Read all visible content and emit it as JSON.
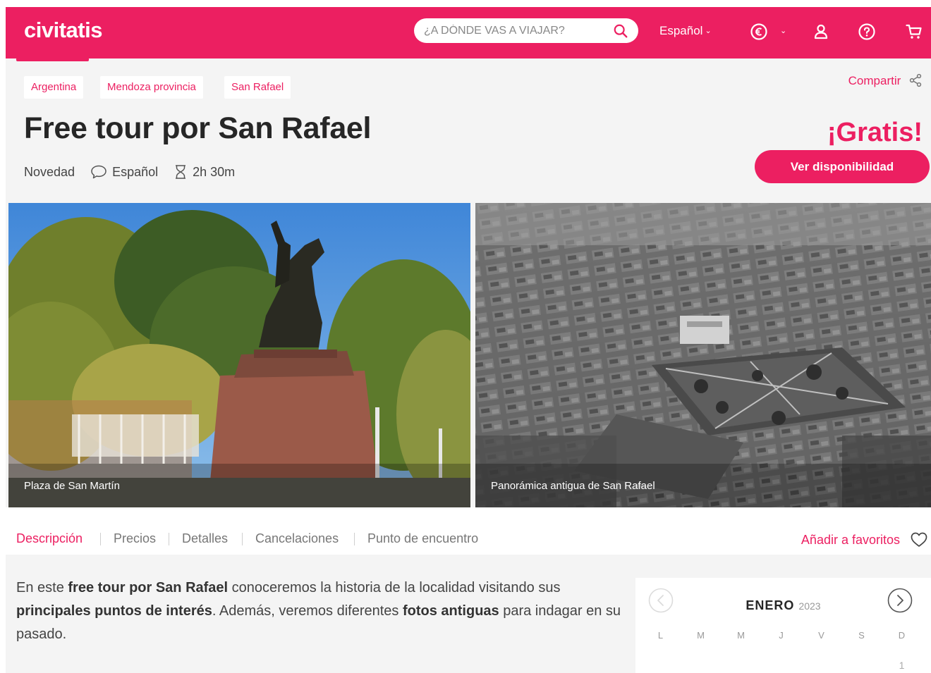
{
  "header": {
    "logo": "civitatis",
    "search_placeholder": "¿A DÓNDE VAS A VIAJAR?",
    "language": "Español",
    "icons": [
      "euro-currency-icon",
      "user-icon",
      "help-icon",
      "cart-icon"
    ]
  },
  "breadcrumbs": [
    "Argentina",
    "Mendoza provincia",
    "San Rafael"
  ],
  "share_label": "Compartir",
  "title": "Free tour por San Rafael",
  "price": "¡Gratis!",
  "meta": {
    "tag": "Novedad",
    "language": "Español",
    "duration": "2h 30m"
  },
  "availability_button": "Ver disponibilidad",
  "photos": [
    {
      "caption": "Plaza de San Martín"
    },
    {
      "caption": "Panorámica antigua de San Rafael"
    }
  ],
  "tabs": [
    "Descripción",
    "Precios",
    "Detalles",
    "Cancelaciones",
    "Punto de encuentro"
  ],
  "active_tab": "Descripción",
  "favorites_label": "Añadir a favoritos",
  "description": {
    "p1": "En este ",
    "b1": "free tour por San Rafael",
    "p2": " conoceremos la historia de la localidad visitando sus ",
    "b2": "principales puntos de interés",
    "p3": ". Además, veremos diferentes ",
    "b3": "fotos antiguas",
    "p4": " para indagar en su pasado."
  },
  "calendar": {
    "month": "ENERO",
    "year": "2023",
    "weekdays": [
      "L",
      "M",
      "M",
      "J",
      "V",
      "S",
      "D"
    ],
    "first_day": "1"
  },
  "colors": {
    "brand": "#ec1f61",
    "page_bg": "#f4f4f4"
  }
}
